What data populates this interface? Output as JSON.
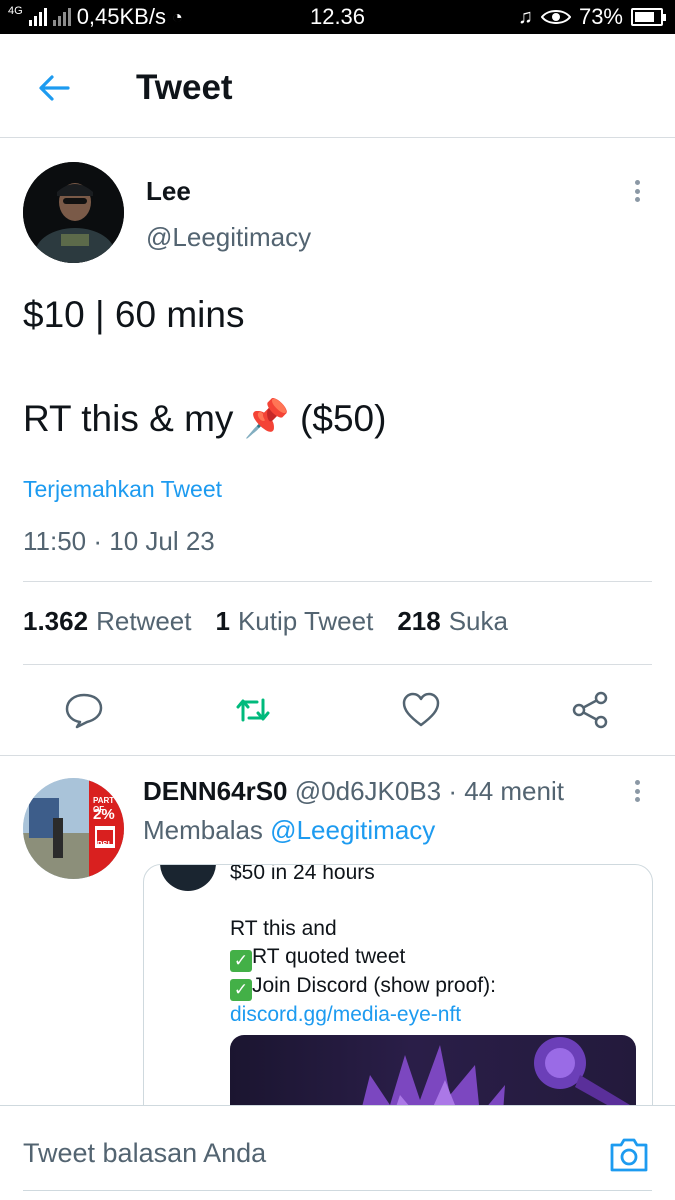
{
  "status_bar": {
    "net_badge": "4G",
    "speed": "0,45KB/s",
    "time": "12.36",
    "battery": "73%"
  },
  "header": {
    "title": "Tweet",
    "back_icon": "arrow-left-icon"
  },
  "tweet": {
    "author_name": "Lee",
    "author_handle": "@Leegitimacy",
    "line1": "$10 | 60 mins",
    "line2_prefix": "RT this & my",
    "line2_emoji": "📌",
    "line2_suffix": "($50)",
    "translate_label": "Terjemahkan Tweet",
    "timestamp": "11:50 · 10 Jul 23",
    "stats": {
      "retweets_count": "1.362",
      "retweets_label": "Retweet",
      "quotes_count": "1",
      "quotes_label": "Kutip Tweet",
      "likes_count": "218",
      "likes_label": "Suka"
    }
  },
  "actions": [
    "reply-icon",
    "retweet-icon",
    "like-icon",
    "share-icon"
  ],
  "reply": {
    "author_name": "DENN64rS0",
    "author_handle": "@0d6JK0B3",
    "time": "· 44 menit",
    "replying_prefix": "Membalas",
    "replying_handle": "@Leegitimacy",
    "avatar_text": {
      "line1": "PART OF",
      "line2": "2%",
      "badge": "PSI"
    },
    "quote": {
      "top_line": "$50 in 24 hours",
      "text_line1": "RT this and",
      "check1": "RT quoted tweet",
      "check2_prefix": "Join Discord (show proof): ",
      "check2_link": "discord.gg/media-eye-nft"
    }
  },
  "compose": {
    "placeholder": "Tweet balasan Anda",
    "camera_icon": "camera-icon"
  },
  "colors": {
    "accent": "#1d9bf0",
    "retweet_green": "#00ba7c",
    "muted": "#536471"
  }
}
